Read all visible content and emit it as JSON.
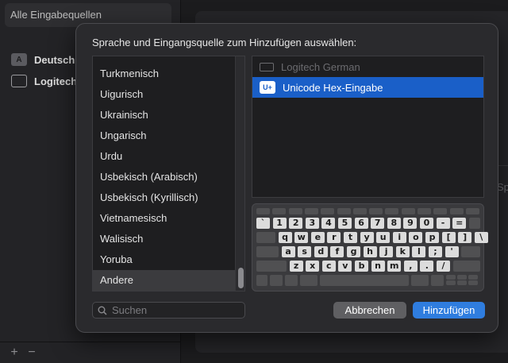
{
  "sidebar": {
    "header": "Alle Eingabequellen",
    "items": [
      {
        "label": "Deutsch",
        "icon": "A"
      },
      {
        "label": "Logitech"
      }
    ],
    "add_label": "+",
    "remove_label": "−"
  },
  "right_panel": {
    "partial_text": "Sp"
  },
  "sheet": {
    "title": "Sprache und Eingangsquelle zum Hinzufügen auswählen:",
    "languages": [
      "Turkmenisch",
      "Uigurisch",
      "Ukrainisch",
      "Ungarisch",
      "Urdu",
      "Usbekisch (Arabisch)",
      "Usbekisch (Kyrillisch)",
      "Vietnamesisch",
      "Walisisch",
      "Yoruba",
      "Andere"
    ],
    "selected_language": "Andere",
    "sources": [
      {
        "label": "Logitech German",
        "state": "disabled"
      },
      {
        "label": "Unicode Hex-Eingabe",
        "state": "selected",
        "icon": "U+"
      }
    ],
    "search_placeholder": "Suchen",
    "cancel_label": "Abbrechen",
    "add_label": "Hinzufügen"
  },
  "keyboard": {
    "row1": [
      "`",
      "1",
      "2",
      "3",
      "4",
      "5",
      "6",
      "7",
      "8",
      "9",
      "0",
      "-",
      "="
    ],
    "row2": [
      "q",
      "w",
      "e",
      "r",
      "t",
      "y",
      "u",
      "i",
      "o",
      "p",
      "[",
      "]",
      "\\"
    ],
    "row3": [
      "a",
      "s",
      "d",
      "f",
      "g",
      "h",
      "j",
      "k",
      "l",
      ";",
      "'"
    ],
    "row4": [
      "z",
      "x",
      "c",
      "v",
      "b",
      "n",
      "m",
      ",",
      ".",
      "/"
    ]
  },
  "colors": {
    "accent": "#2f7ddf",
    "selected_row": "#1a5fc8"
  }
}
